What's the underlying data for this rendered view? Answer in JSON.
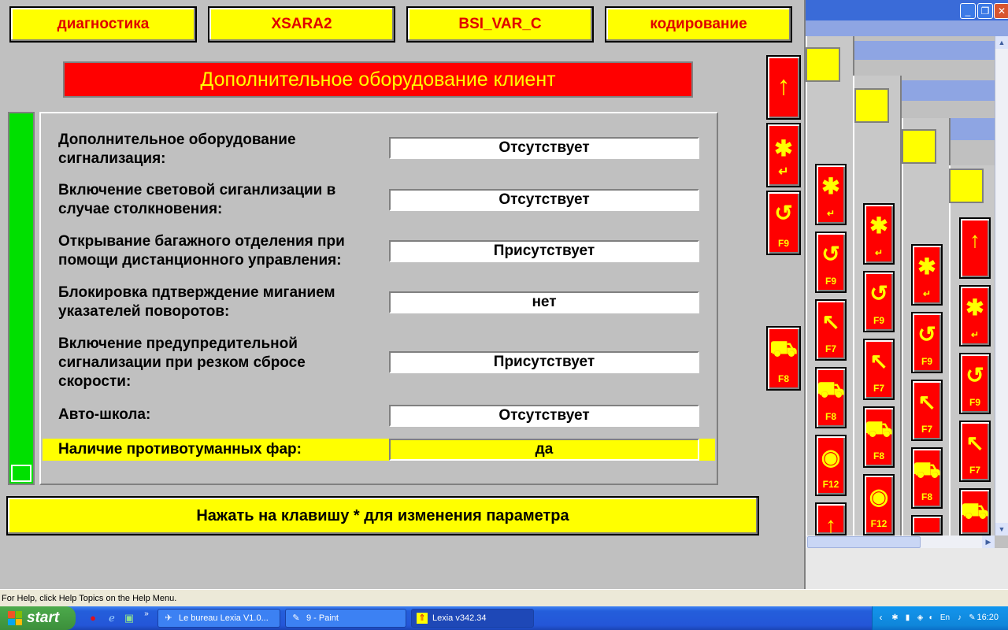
{
  "header_buttons": [
    "диагностика",
    "XSARA2",
    "BSI_VAR_C",
    "кодирование"
  ],
  "page_title": "Дополнительное оборудование клиент",
  "parameters": [
    {
      "label": "Дополнительное оборудование\nсигнализация:",
      "value": "Отсутствует"
    },
    {
      "label": "Включение световой сиганлизации в\nслучае столкновения:",
      "value": "Отсутствует"
    },
    {
      "label": "Открывание багажного отделения при\nпомощи дистанционного управления:",
      "value": "Присутствует"
    },
    {
      "label": "Блокировка пдтверждение миганием\nуказателей поворотов:",
      "value": "нет"
    },
    {
      "label": "Включение предупредительной\nсигнализации при резком сбросе\nскорости:",
      "value": "Присутствует"
    },
    {
      "label": "Авто-школа:",
      "value": "Отсутствует"
    },
    {
      "label": "Наличие противотуманных фар:",
      "value": "да",
      "selected": true
    }
  ],
  "hint": "Нажать на клавишу * для изменения параметра",
  "side_keys": {
    "up_icon": "arrow-up-icon",
    "confirm_icon": "asterisk-enter-icon",
    "back": {
      "icon": "undo-icon",
      "label": "F9"
    },
    "help": {
      "icon": "car-icon",
      "label": "F8"
    }
  },
  "background_tile_labels": [
    "F9",
    "F7",
    "F8",
    "F12"
  ],
  "status_bar": "For Help, click Help Topics on the Help Menu.",
  "taskbar": {
    "start_label": "start",
    "tasks": [
      "Le bureau Lexia V1.0...",
      "9 - Paint",
      "Lexia v342.34"
    ],
    "tray_language": "En",
    "clock": "16:20"
  },
  "colors": {
    "accent_yellow": "#ffff00",
    "accent_red": "#ff0000",
    "progress_green": "#00e000",
    "label_red": "#e00000"
  }
}
